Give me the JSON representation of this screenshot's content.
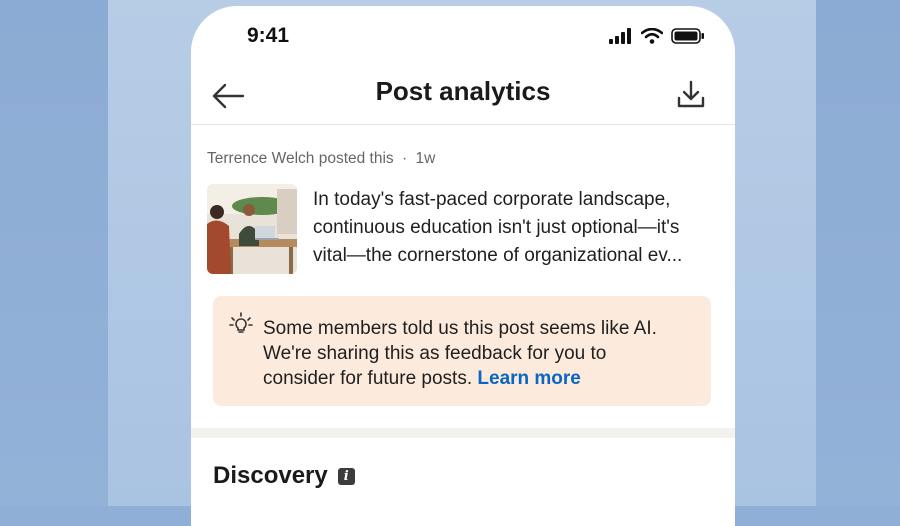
{
  "status_bar": {
    "time": "9:41"
  },
  "header": {
    "title": "Post analytics"
  },
  "post": {
    "meta_author": "Terrence Welch posted this",
    "meta_separator": "·",
    "meta_age": "1w",
    "text_lines": [
      "In today's fast-paced corporate landscape,",
      "continuous education isn't just optional—it's",
      "vital—the cornerstone of organizational ev..."
    ]
  },
  "notice": {
    "text_line1": "Some members told us this post seems like AI.",
    "text_line2": "We're sharing this as feedback for you to",
    "text_line3": "consider for future posts.",
    "link_label": "Learn more"
  },
  "discovery": {
    "title": "Discovery",
    "info_icon_label": "i"
  },
  "icons": {
    "back": "arrow-left-icon",
    "download": "download-icon",
    "bulb": "lightbulb-icon",
    "info": "info-icon",
    "signal": "cellular-signal-icon",
    "wifi": "wifi-icon",
    "battery": "battery-icon"
  },
  "colors": {
    "link": "#0a66c2",
    "notice_bg": "#fcebdd",
    "background": "#a9c3e2"
  }
}
